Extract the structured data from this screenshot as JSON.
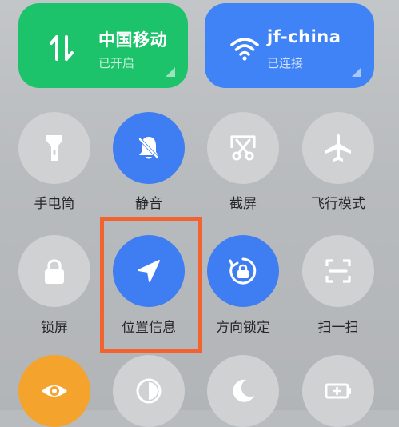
{
  "tiles": {
    "mobile": {
      "title": "中国移动",
      "status": "已开启",
      "color": "#1dc36a",
      "icon": "mobile-data-icon"
    },
    "wifi": {
      "title": "jf-china",
      "status": "已连接",
      "color": "#3f83f6",
      "icon": "wifi-icon"
    }
  },
  "toggles": {
    "flashlight": {
      "label": "手电筒",
      "icon": "flashlight-icon",
      "active": false
    },
    "mute": {
      "label": "静音",
      "icon": "bell-off-icon",
      "active": true
    },
    "screenshot": {
      "label": "截屏",
      "icon": "scissors-icon",
      "active": false
    },
    "airplane": {
      "label": "飞行模式",
      "icon": "airplane-icon",
      "active": false
    },
    "lock": {
      "label": "锁屏",
      "icon": "lock-icon",
      "active": false
    },
    "location": {
      "label": "位置信息",
      "icon": "location-arrow-icon",
      "active": true
    },
    "rotation": {
      "label": "方向锁定",
      "icon": "rotation-lock-icon",
      "active": true
    },
    "scan": {
      "label": "扫一扫",
      "icon": "scan-icon",
      "active": false
    },
    "eye": {
      "icon": "eye-icon",
      "active": true
    },
    "contrast": {
      "icon": "contrast-icon",
      "active": false
    },
    "dark": {
      "icon": "moon-icon",
      "active": false
    },
    "battery": {
      "icon": "battery-saver-icon",
      "active": false
    }
  },
  "colors": {
    "active_blue": "#3f7df3",
    "inactive_gray": "#cfd1d3",
    "highlight": "#f2632f",
    "orange": "#f4a42d"
  }
}
